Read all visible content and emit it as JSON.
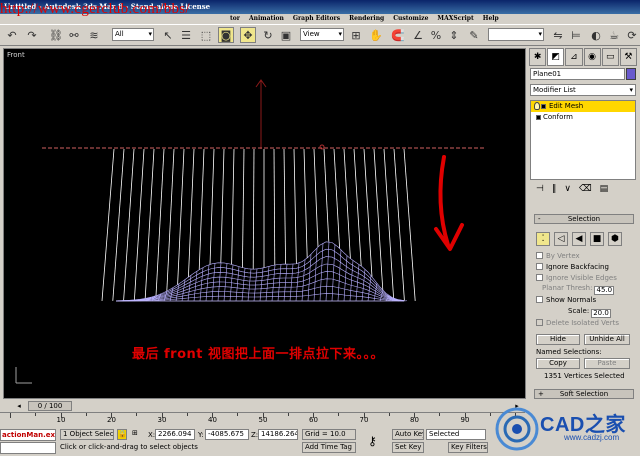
{
  "window": {
    "title": "Untitled - Autodesk 3ds Max 8 - Stand-alone License",
    "watermark_url": "http://www.cgerclub.com/bbs/"
  },
  "menu": [
    "tor",
    "Animation",
    "Graph Editors",
    "Rendering",
    "Customize",
    "MAXScript",
    "Help"
  ],
  "toolbar": {
    "selection_filter": "All",
    "reference_coord": "View"
  },
  "viewport": {
    "label": "Front",
    "caption": "最后 front 视图把上面一排点拉下来。。。"
  },
  "command_panel": {
    "object_name": "Plane01",
    "object_color": "#6a5acd",
    "modifier_list_label": "Modifier List",
    "stack": [
      {
        "label": "Edit Mesh",
        "selected": true
      },
      {
        "label": "Conform",
        "selected": false
      }
    ],
    "selection_rollout": {
      "title": "Selection",
      "by_vertex": "By Vertex",
      "ignore_backfacing": "Ignore Backfacing",
      "ignore_visible_edges": "Ignore Visible Edges",
      "planar_thresh_label": "Planar Thresh:",
      "planar_thresh_value": "45.0",
      "show_normals": "Show Normals",
      "scale_label": "Scale:",
      "scale_value": "20.0",
      "delete_isolated": "Delete Isolated Verts",
      "hide_button": "Hide",
      "unhide_all_button": "Unhide All",
      "named_selections_label": "Named Selections:",
      "copy_button": "Copy",
      "paste_button": "Paste",
      "vertices_selected": "1351 Vertices Selected"
    },
    "soft_selection_title": "Soft Selection"
  },
  "timeline": {
    "slider_label": "0 / 100",
    "ticks": [
      "10",
      "20",
      "30",
      "40",
      "50",
      "60",
      "70",
      "80",
      "90"
    ]
  },
  "status": {
    "maxscript_text": "actionMan.ex",
    "objects_selected": "1 Object Selecte",
    "x_label": "X:",
    "x_value": "2266.094",
    "y_label": "Y:",
    "y_value": "-4085.675",
    "z_label": "Z:",
    "z_value": "14186.264",
    "grid": "Grid = 10.0",
    "auto_key": "Auto Key",
    "set_key": "Set Key",
    "key_mode": "Selected",
    "key_filters": "Key Filters...",
    "prompt": "Click or click-and-drag to select objects",
    "add_time_tag": "Add Time Tag"
  },
  "logo": {
    "text": "CAD之家",
    "url": "www.cadzj.com"
  }
}
